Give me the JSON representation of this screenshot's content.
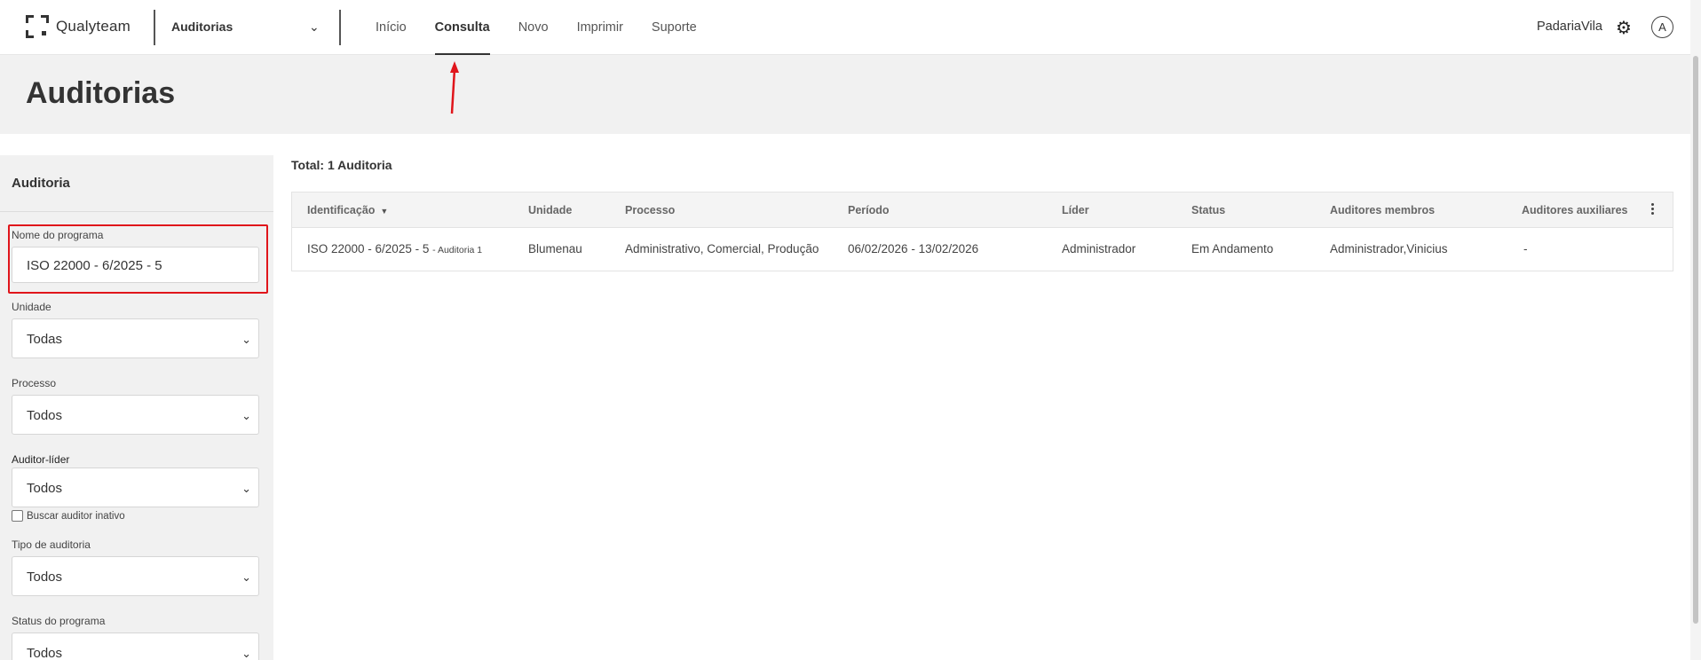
{
  "header": {
    "brand": "Qualyteam",
    "module": "Auditorias",
    "nav": [
      "Início",
      "Consulta",
      "Novo",
      "Imprimir",
      "Suporte"
    ],
    "active_nav": "Consulta",
    "user": "PadariaVila",
    "avatar_initial": "A"
  },
  "page": {
    "title": "Auditorias"
  },
  "filters": {
    "title": "Auditoria",
    "program_name": {
      "label": "Nome do programa",
      "value": "ISO 22000 - 6/2025 - 5"
    },
    "unit": {
      "label": "Unidade",
      "value": "Todas"
    },
    "process": {
      "label": "Processo",
      "value": "Todos"
    },
    "lead_auditor": {
      "label": "Auditor-líder",
      "value": "Todos"
    },
    "inactive_auditor": {
      "label": "Buscar auditor inativo",
      "checked": false
    },
    "audit_type": {
      "label": "Tipo de auditoria",
      "value": "Todos"
    },
    "program_status": {
      "label": "Status do programa",
      "value": "Todos"
    }
  },
  "results": {
    "total": "Total: 1 Auditoria",
    "columns": [
      "Identificação",
      "Unidade",
      "Processo",
      "Período",
      "Líder",
      "Status",
      "Auditores membros",
      "Auditores auxiliares"
    ],
    "rows": [
      {
        "id": "ISO 22000 - 6/2025 - 5",
        "id_suffix": "- Auditoria 1",
        "unit": "Blumenau",
        "process": "Administrativo, Comercial, Produção",
        "period": "06/02/2026 - 13/02/2026",
        "leader": "Administrador",
        "status": "Em Andamento",
        "members": "Administrador,Vinicius",
        "auxiliaries": "-"
      }
    ]
  },
  "colors": {
    "highlight": "#e0151b",
    "page_bg": "#f1f1f1"
  }
}
